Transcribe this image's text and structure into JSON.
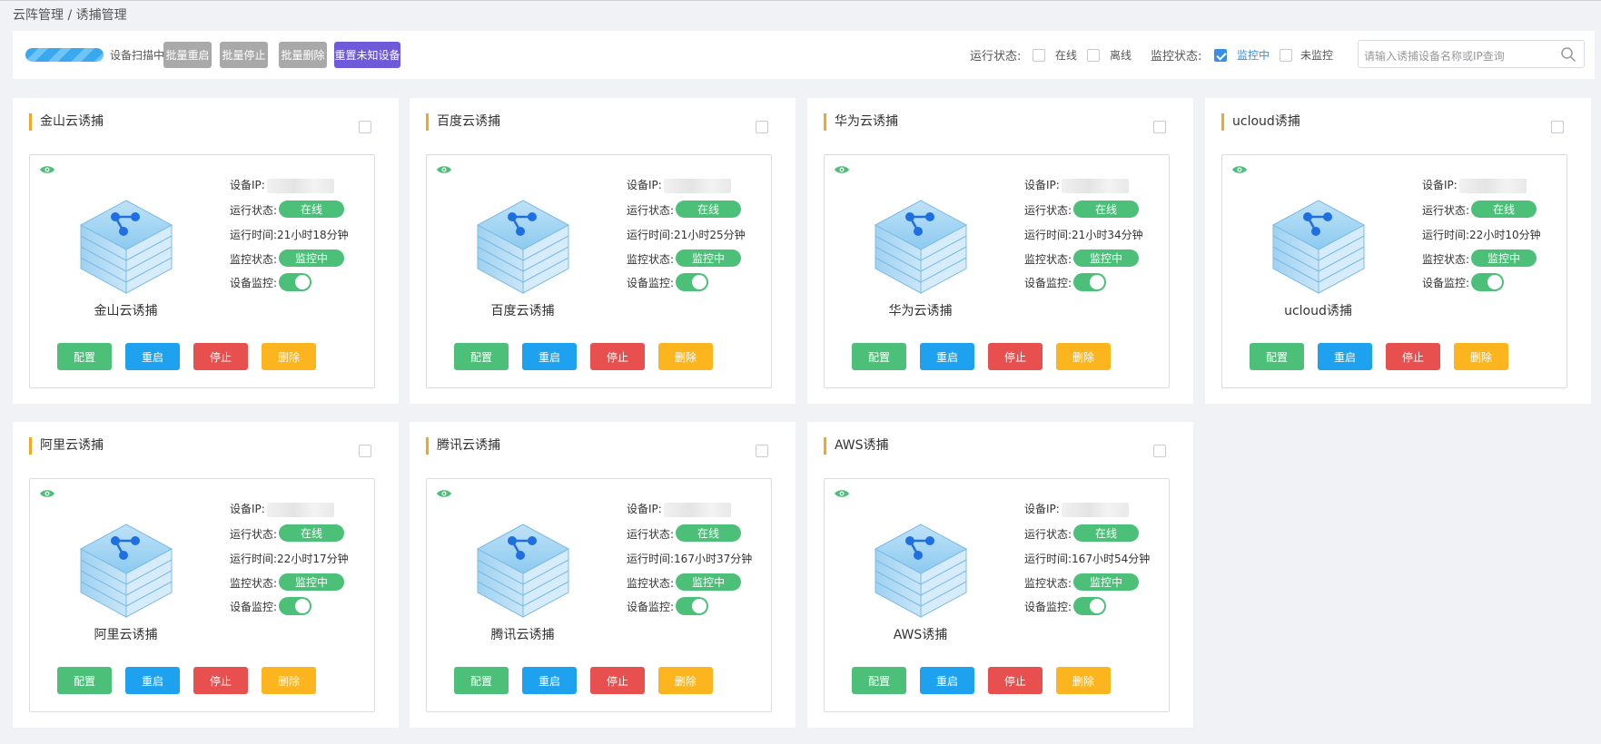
{
  "breadcrumb": {
    "root": "云阵管理",
    "separator": " / ",
    "current": "诱捕管理"
  },
  "toolbar": {
    "scan_text": "设备扫描中...",
    "batch_restart": "批量重启",
    "batch_stop": "批量停止",
    "batch_delete": "批量删除",
    "reset_unknown": "重置未知设备",
    "run_status_label": "运行状态:",
    "online_label": "在线",
    "offline_label": "离线",
    "monitor_status_label": "监控状态:",
    "monitoring_label": "监控中",
    "unmonitored_label": "未监控",
    "search_placeholder": "请输入诱捕设备名称或IP查询"
  },
  "labels": {
    "ip": "设备IP:",
    "run_status": "运行状态:",
    "run_time": "运行时间:",
    "monitor_status": "监控状态:",
    "device_monitor": "设备监控:",
    "configure": "配置",
    "restart": "重启",
    "stop": "停止",
    "delete": "删除"
  },
  "cards": [
    {
      "title": "金山云诱捕",
      "name": "金山云诱捕",
      "status": "在线",
      "runtime": "21小时18分钟",
      "monitor": "监控中"
    },
    {
      "title": "百度云诱捕",
      "name": "百度云诱捕",
      "status": "在线",
      "runtime": "21小时25分钟",
      "monitor": "监控中"
    },
    {
      "title": "华为云诱捕",
      "name": "华为云诱捕",
      "status": "在线",
      "runtime": "21小时34分钟",
      "monitor": "监控中"
    },
    {
      "title": "ucloud诱捕",
      "name": "ucloud诱捕",
      "status": "在线",
      "runtime": "22小时10分钟",
      "monitor": "监控中"
    },
    {
      "title": "阿里云诱捕",
      "name": "阿里云诱捕",
      "status": "在线",
      "runtime": "22小时17分钟",
      "monitor": "监控中"
    },
    {
      "title": "腾讯云诱捕",
      "name": "腾讯云诱捕",
      "status": "在线",
      "runtime": "167小时37分钟",
      "monitor": "监控中"
    },
    {
      "title": "AWS诱捕",
      "name": "AWS诱捕",
      "status": "在线",
      "runtime": "167小时54分钟",
      "monitor": "监控中"
    }
  ]
}
